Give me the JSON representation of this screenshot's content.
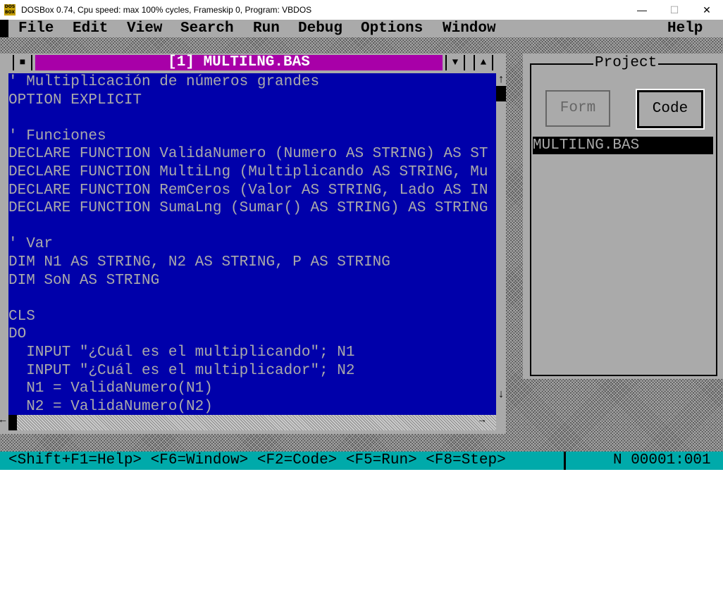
{
  "window": {
    "title": "DOSBox 0.74, Cpu speed: max 100% cycles, Frameskip  0, Program:    VBDOS",
    "logo_text": "DOS BOX",
    "minimize": "—",
    "maximize": "☐",
    "close": "✕"
  },
  "menu": {
    "items": [
      "File",
      "Edit",
      "View",
      "Search",
      "Run",
      "Debug",
      "Options",
      "Window"
    ],
    "help": "Help"
  },
  "editor": {
    "title": "[1] MULTILNG.BAS",
    "system_icon": "■",
    "down_icon": "▼",
    "up_icon": "▲",
    "scroll_up": "↑",
    "scroll_down": "↓",
    "scroll_left": "←",
    "scroll_right": "→",
    "lines": [
      "' Multiplicación de números grandes",
      "OPTION EXPLICIT",
      "",
      "' Funciones",
      "DECLARE FUNCTION ValidaNumero (Numero AS STRING) AS ST",
      "DECLARE FUNCTION MultiLng (Multiplicando AS STRING, Mu",
      "DECLARE FUNCTION RemCeros (Valor AS STRING, Lado AS IN",
      "DECLARE FUNCTION SumaLng (Sumar() AS STRING) AS STRING",
      "",
      "' Var",
      "DIM N1 AS STRING, N2 AS STRING, P AS STRING",
      "DIM SoN AS STRING",
      "",
      "CLS",
      "DO",
      "  INPUT \"¿Cuál es el multiplicando\"; N1",
      "  INPUT \"¿Cuál es el multiplicador\"; N2",
      "  N1 = ValidaNumero(N1)",
      "  N2 = ValidaNumero(N2)"
    ]
  },
  "project": {
    "title": "Project",
    "form_button": "Form",
    "code_button": "Code",
    "files": [
      "MULTILNG.BAS"
    ]
  },
  "status": {
    "hints": "<Shift+F1=Help> <F6=Window> <F2=Code> <F5=Run> <F8=Step>",
    "position": "N 00001:001"
  }
}
